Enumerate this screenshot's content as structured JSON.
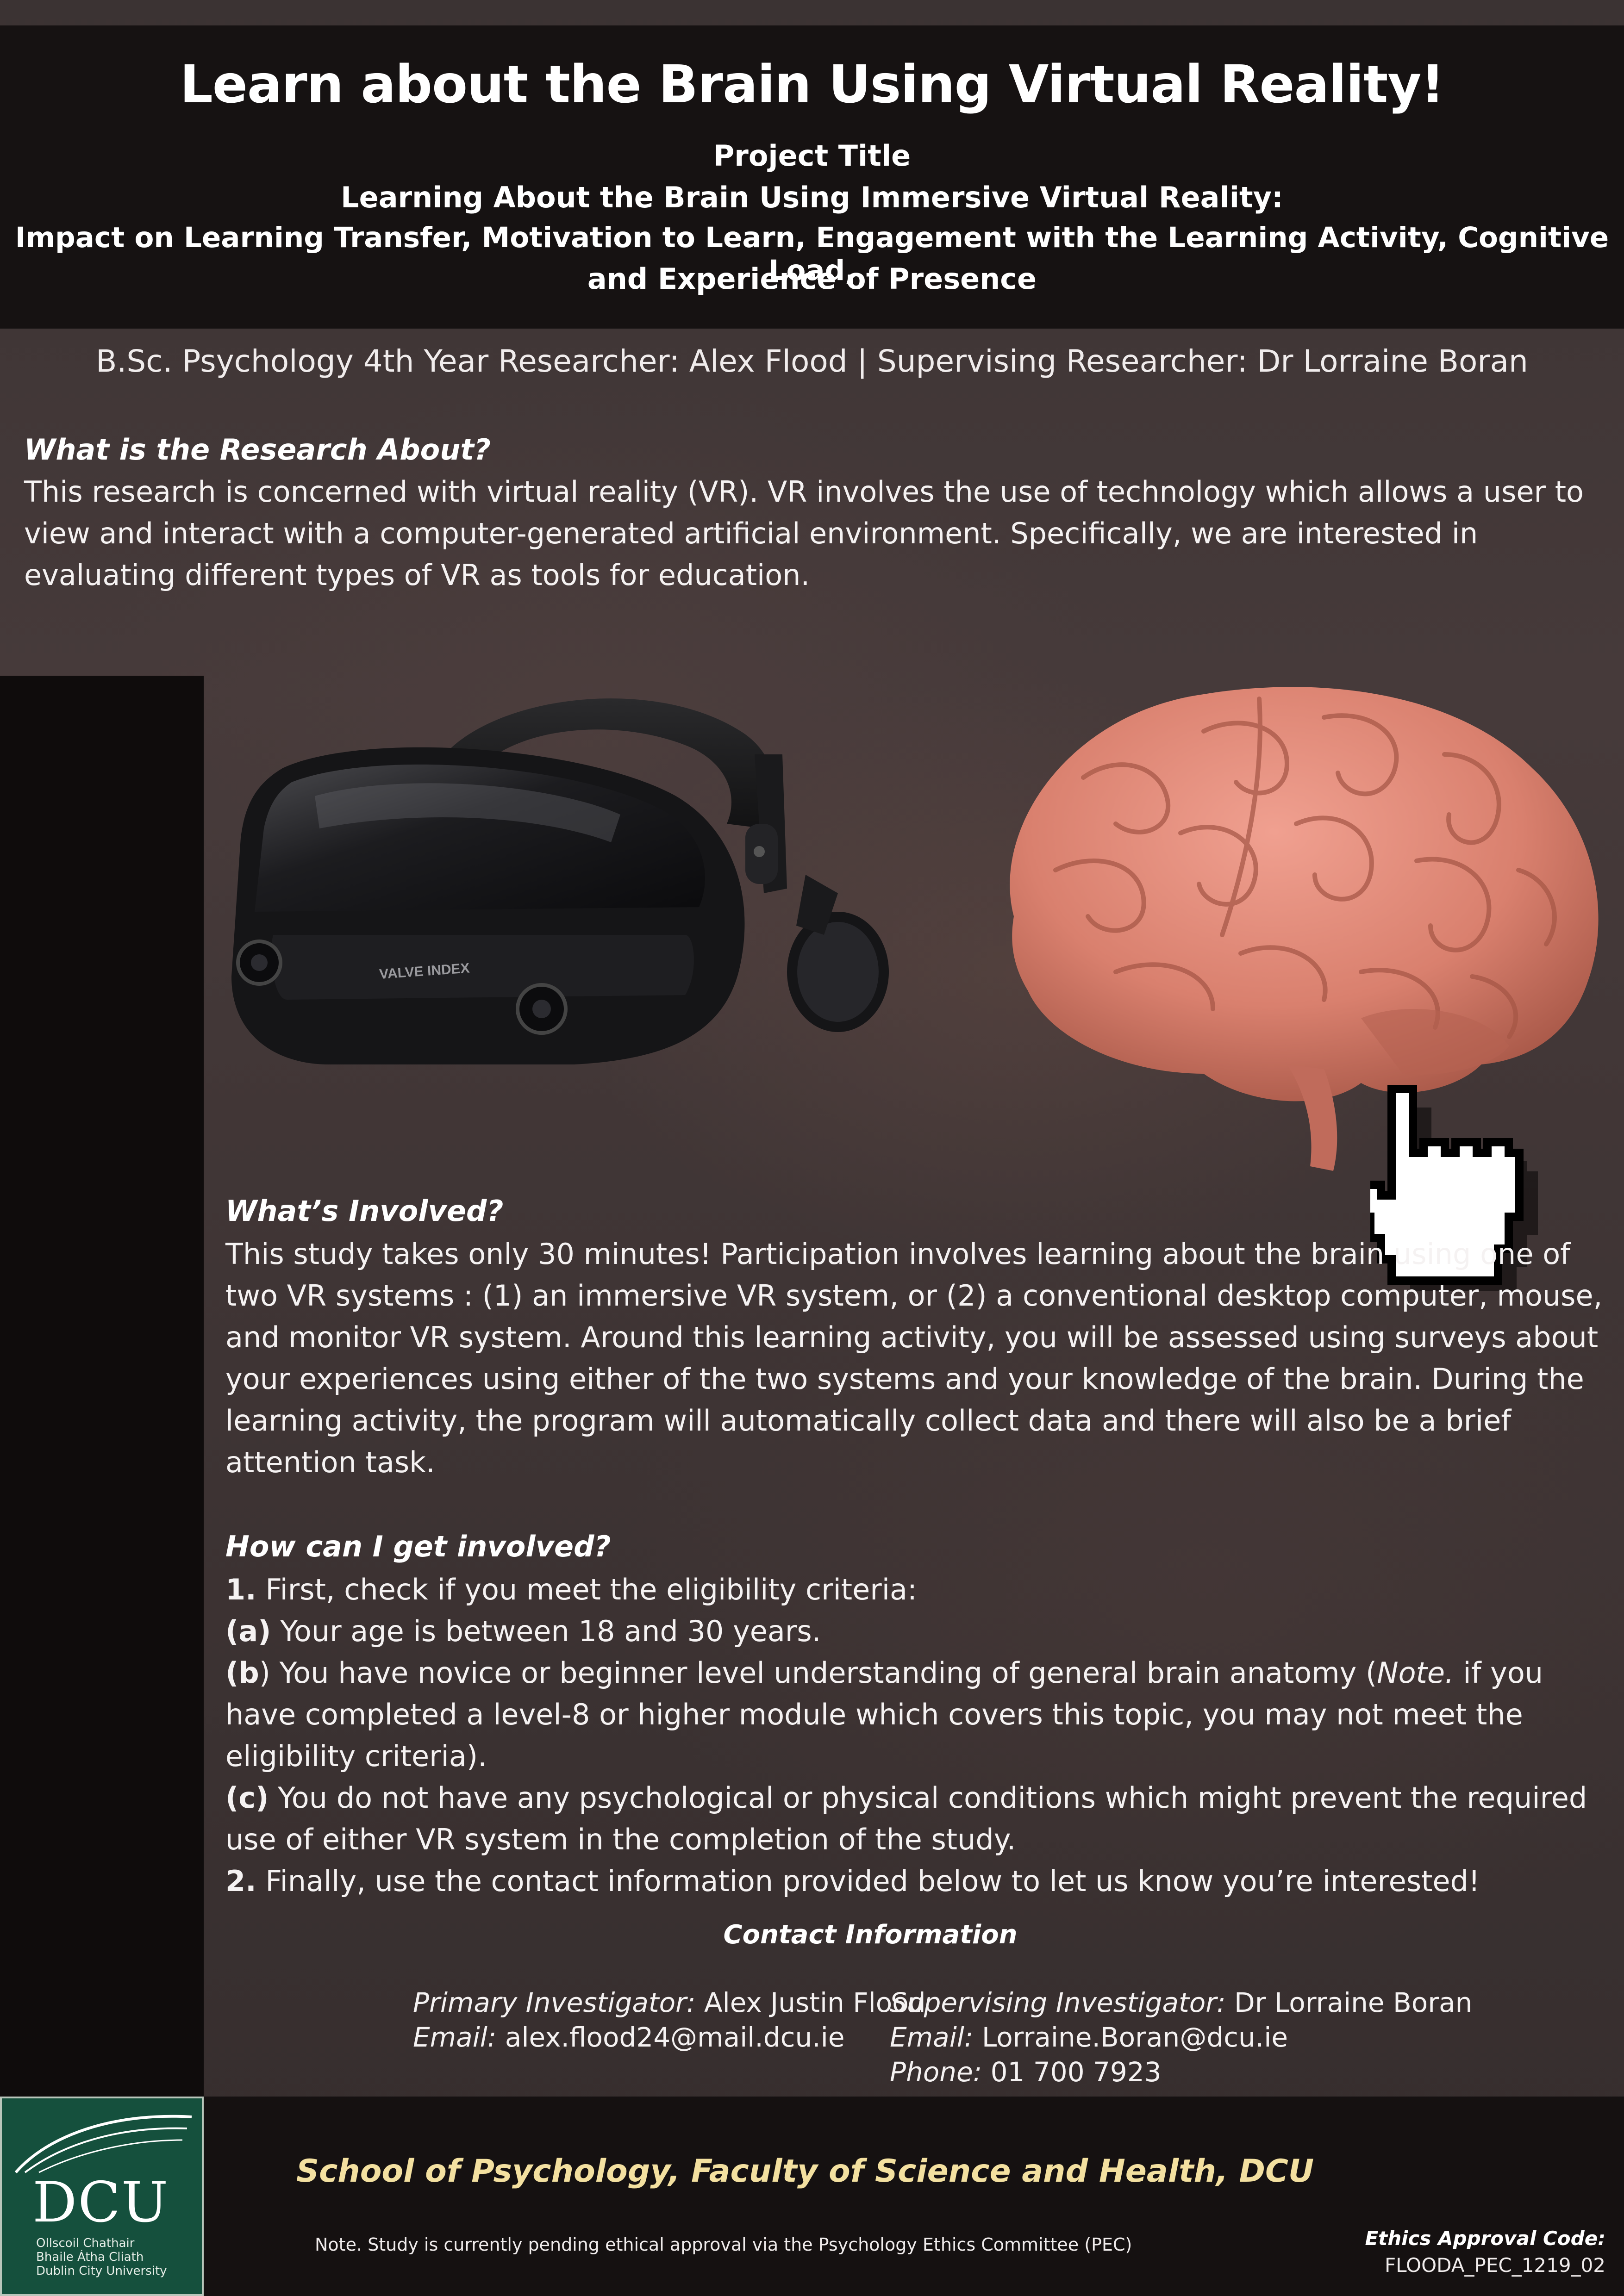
{
  "header": {
    "title": "Learn about the Brain Using Virtual Reality!",
    "project_title_label": "Project Title",
    "project_title_line1": "Learning About the Brain Using Immersive Virtual Reality:",
    "project_title_line2": "Impact on Learning Transfer, Motivation to Learn, Engagement with the Learning Activity, Cognitive Load,",
    "project_title_line3": "and Experience of Presence"
  },
  "researchers": "B.Sc. Psychology 4th Year Researcher: Alex Flood | Supervising Researcher: Dr Lorraine Boran",
  "sections": {
    "research_about": {
      "heading": "What is the Research About?",
      "body": "This research is concerned with virtual reality (VR). VR involves the use of technology which allows a user to view and interact with a computer-generated artificial environment.  Specifically, we are interested in evaluating different types of VR as tools for education."
    },
    "involved": {
      "heading": "What’s Involved?",
      "body": "This study takes only 30 minutes! Participation involves learning about the brain using one of two VR systems : (1) an immersive VR system, or (2) a conventional desktop computer, mouse, and monitor VR system. Around this learning activity, you will be assessed using surveys about your experiences using either of the two systems and your knowledge of the brain. During the learning activity, the program will automatically collect data and there will also be a brief attention task."
    },
    "get_involved": {
      "heading": "How can I get involved?",
      "step1_num": "1.",
      "step1_text": " First, check if you meet the eligibility criteria:",
      "a_label": "(a)",
      "a_text": " Your age is between 18 and 30 years.",
      "b_label": "(b",
      "b_text1": ") You have novice or beginner level understanding of general brain anatomy (",
      "b_note": "Note.",
      "b_text2": " if you have completed a level-8 or higher module which covers this topic, you may not meet the eligibility criteria).",
      "c_label": "(c)",
      "c_text": " You do not have any psychological or physical conditions which might prevent the required use of either VR system in the completion of the study.",
      "step2_num": "2.",
      "step2_text": " Finally, use the contact information provided below to let us know you’re interested!"
    }
  },
  "contact": {
    "heading": "Contact Information",
    "primary_label": "Primary Investigator:",
    "primary_name": " Alex Justin Flood",
    "primary_email_label": "Email:",
    "primary_email": " alex.flood24@mail.dcu.ie",
    "supervisor_label": "Supervising Investigator:",
    "supervisor_name": " Dr Lorraine Boran",
    "supervisor_email_label": "Email:",
    "supervisor_email": " Lorraine.Boran@dcu.ie",
    "phone_label": "Phone:",
    "phone": " 01 700 7923"
  },
  "images": {
    "headset_icon": "vr-headset-icon",
    "headset_brand": "VALVE INDEX",
    "brain_icon": "brain-model-icon",
    "cursor_icon": "pointing-hand-cursor-icon"
  },
  "footer": {
    "logo_text": "DCU",
    "logo_sub1": "Ollscoil Chathair",
    "logo_sub2": "Bhaile Átha Cliath",
    "logo_sub3": "Dublin City University",
    "school": "School of Psychology, Faculty of Science and Health, DCU",
    "ethics_note": "Note. Study is currently pending ethical approval via the Psychology Ethics Committee (PEC)",
    "ethics_code_label": "Ethics Approval Code:",
    "ethics_code": "FLOODA_PEC_1219_02"
  },
  "colors": {
    "header_band": "#161212",
    "school_text": "#f3e0a0",
    "logo_green": "#15503d"
  }
}
